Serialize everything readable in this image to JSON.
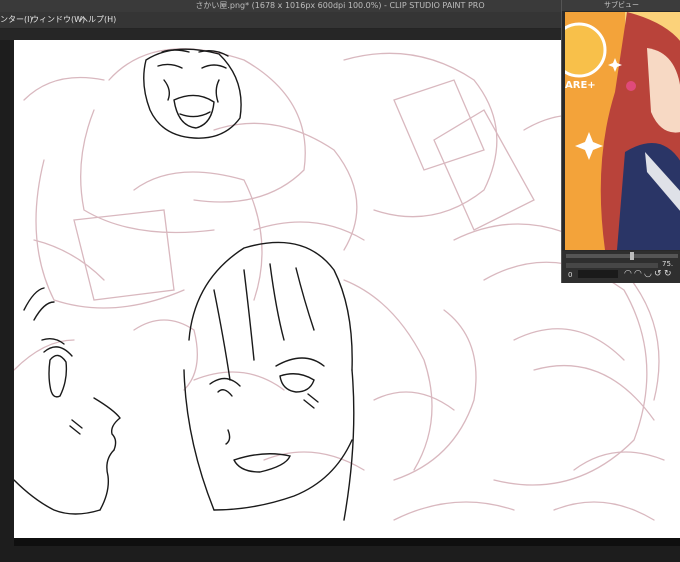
{
  "window": {
    "title": "さかい屋.png* (1678 x 1016px 600dpi 100.0%)  - CLIP STUDIO PAINT PRO"
  },
  "menu": {
    "items": [
      {
        "label": "ンター(I)"
      },
      {
        "label": "ウィンドウ(W)"
      },
      {
        "label": "ヘルプ(H)"
      }
    ]
  },
  "subview": {
    "title": "サブビュー",
    "card_badge": "ARE+",
    "zoom_value": "75.",
    "rotation_value": "0"
  },
  "colors": {
    "sketch_pink": "#d9b8bf",
    "ink_line": "#1a1a1a",
    "card_orange": "#f3a33a",
    "card_hair": "#b9433a",
    "uniform_navy": "#2a3566"
  }
}
